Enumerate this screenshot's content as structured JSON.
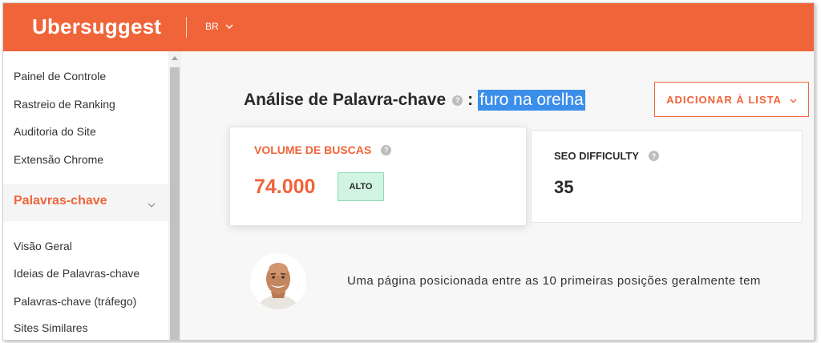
{
  "header": {
    "logo": "Ubersuggest",
    "country": "BR"
  },
  "sidebar": {
    "items_top": [
      "Painel de Controle",
      "Rastreio de Ranking",
      "Auditoria do Site",
      "Extensão Chrome"
    ],
    "section": "Palavras-chave",
    "items_sub": [
      "Visão Geral",
      "Ideias de Palavras-chave",
      "Palavras-chave (tráfego)",
      "Sites Similares"
    ]
  },
  "main": {
    "title": "Análise de Palavra-chave",
    "help": "?",
    "colon": ":",
    "keyword": "furo na orelha",
    "add_button": "ADICIONAR À LISTA",
    "volume": {
      "label": "VOLUME DE BUSCAS",
      "value": "74.000",
      "badge": "ALTO"
    },
    "seo": {
      "label": "SEO DIFFICULTY",
      "value": "35"
    },
    "tip": "Uma página posicionada entre as 10 primeiras posições geralmente tem"
  },
  "colors": {
    "brand": "#f0643a",
    "badge_bg": "#d2f4e2",
    "selection": "#3b8eea"
  },
  "icons": [
    "chevron-down-icon",
    "help-icon",
    "avatar-photo"
  ]
}
